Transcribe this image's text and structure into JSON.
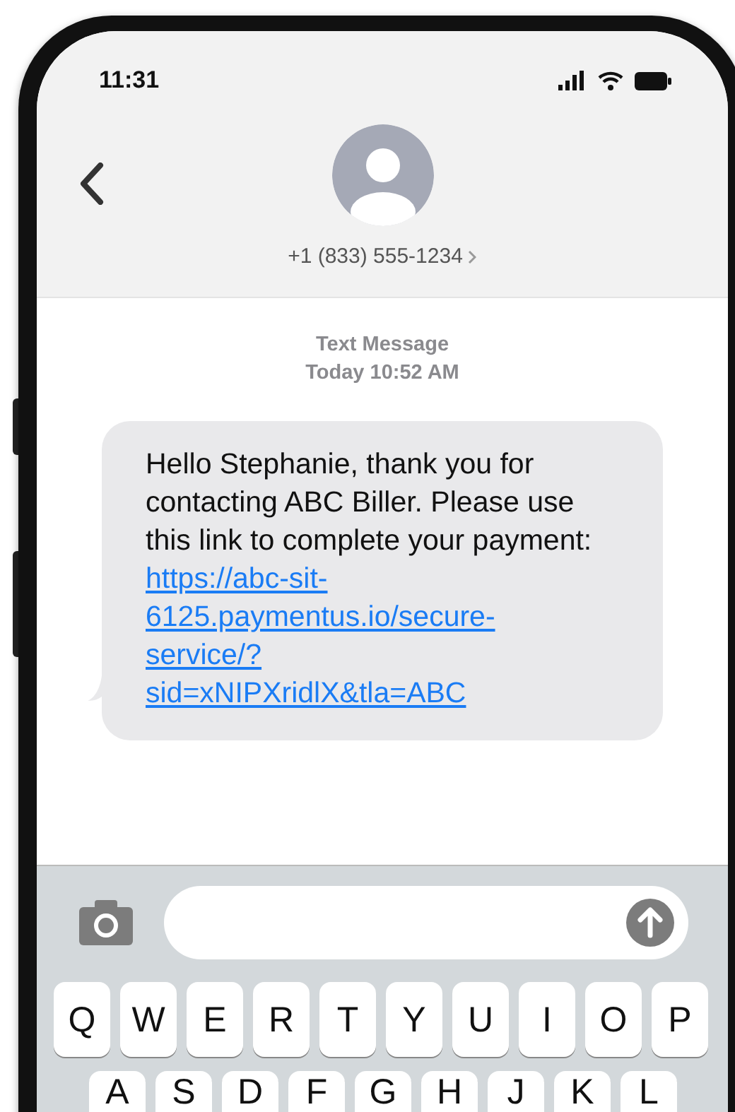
{
  "status_bar": {
    "time": "11:31"
  },
  "header": {
    "contact": "+1 (833) 555-1234"
  },
  "thread": {
    "label": "Text Message",
    "timestamp": "Today 10:52 AM"
  },
  "messages": [
    {
      "text": "Hello Stephanie, thank you for contacting ABC Biller. Please use this link to complete your payment:",
      "link": "https://abc-sit-6125.paymentus.io/secure-service/?sid=xNIPXridlX&tla=ABC"
    }
  ],
  "keyboard": {
    "rows": [
      [
        "Q",
        "W",
        "E",
        "R",
        "T",
        "Y",
        "U",
        "I",
        "O",
        "P"
      ],
      [
        "A",
        "S",
        "D",
        "F",
        "G",
        "H",
        "J",
        "K",
        "L"
      ]
    ]
  }
}
